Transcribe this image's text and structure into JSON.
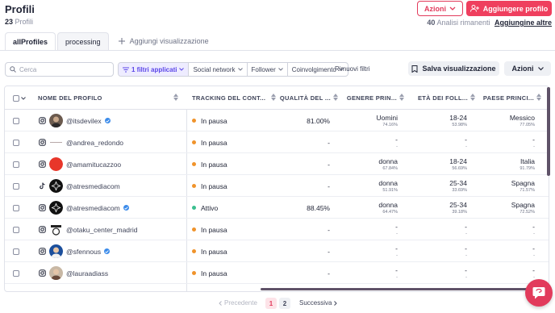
{
  "header": {
    "title": "Profili",
    "count": "23",
    "count_label": "Profili"
  },
  "top_actions": {
    "azioni_label": "Azioni",
    "add_label": "Aggiungere profilo",
    "remaining_count": "40",
    "remaining_label": "Analisi rimanenti",
    "add_more_label": "Aggiungine altre"
  },
  "tabs": [
    {
      "label": "allProfiles",
      "active": true
    },
    {
      "label": "processing",
      "active": false
    }
  ],
  "add_view_label": "Aggiungi visualizzazione",
  "toolbar": {
    "search_placeholder": "Cerca",
    "filters_applied": "1 filtri applicati",
    "filter_social": "Social network",
    "filter_follower": "Follower",
    "filter_engagement": "Coinvolgimento",
    "clear_filters": "Rimuovi filtri",
    "save_view": "Salva visualizzazione",
    "azioni": "Azioni"
  },
  "table": {
    "columns": [
      "NOME DEL PROFILO",
      "TRACKING DEL CONT...",
      "QUALITÀ DEL ...",
      "GENERE PRIN...",
      "ETÀ DEI FOLL...",
      "PAESE PRINCI..."
    ],
    "rows": [
      {
        "platform": "instagram",
        "handle": "@itsdevilex",
        "verified": true,
        "avatar": "photo-dark",
        "status": "In pausa",
        "status_color": "#f0932b",
        "quality": "81.00%",
        "gender": "Uomini",
        "gender_pct": "74.16%",
        "age": "18-24",
        "age_pct": "53.98%",
        "country": "Messico",
        "country_pct": "77.05%"
      },
      {
        "platform": "instagram",
        "handle": "@andrea_redondo",
        "verified": false,
        "avatar": "logo-text",
        "status": "In pausa",
        "status_color": "#f0932b",
        "quality": "-",
        "gender": "-",
        "gender_pct": "-",
        "age": "-",
        "age_pct": "-",
        "country": "-",
        "country_pct": "-"
      },
      {
        "platform": "instagram",
        "handle": "@amamitucazzoo",
        "verified": false,
        "avatar": "red-circle",
        "status": "In pausa",
        "status_color": "#f0932b",
        "quality": "-",
        "gender": "donna",
        "gender_pct": "67.84%",
        "age": "18-24",
        "age_pct": "56.69%",
        "country": "Italia",
        "country_pct": "91.79%"
      },
      {
        "platform": "tiktok",
        "handle": "@atresmediacom",
        "verified": false,
        "avatar": "black-logo",
        "status": "In pausa",
        "status_color": "#f0932b",
        "quality": "-",
        "gender": "donna",
        "gender_pct": "51.91%",
        "age": "25-34",
        "age_pct": "33.69%",
        "country": "Spagna",
        "country_pct": "71.57%"
      },
      {
        "platform": "instagram",
        "handle": "@atresmediacom",
        "verified": true,
        "avatar": "black-logo",
        "status": "Attivo",
        "status_color": "#3bbf8f",
        "quality": "88.45%",
        "gender": "donna",
        "gender_pct": "64.47%",
        "age": "25-34",
        "age_pct": "39.18%",
        "country": "Spagna",
        "country_pct": "72.52%"
      },
      {
        "platform": "instagram",
        "handle": "@otaku_center_madrid",
        "verified": false,
        "avatar": "otaku-logo",
        "status": "In pausa",
        "status_color": "#f0932b",
        "quality": "-",
        "gender": "-",
        "gender_pct": "-",
        "age": "-",
        "age_pct": "-",
        "country": "-",
        "country_pct": "-"
      },
      {
        "platform": "instagram",
        "handle": "@sfennous",
        "verified": true,
        "avatar": "photo-blue",
        "status": "In pausa",
        "status_color": "#f0932b",
        "quality": "-",
        "gender": "-",
        "gender_pct": "-",
        "age": "-",
        "age_pct": "-",
        "country": "-",
        "country_pct": "-"
      },
      {
        "platform": "instagram",
        "handle": "@lauraadiass",
        "verified": false,
        "avatar": "photo-light",
        "status": "In pausa",
        "status_color": "#f0932b",
        "quality": "-",
        "gender": "-",
        "gender_pct": "-",
        "age": "-",
        "age_pct": "-",
        "country": "-",
        "country_pct": "-"
      }
    ]
  },
  "pagination": {
    "prev": "Precedente",
    "pages": [
      "1",
      "2"
    ],
    "current": "1",
    "next": "Successiva"
  },
  "colors": {
    "brand": "#ef3f5e",
    "accent_purple": "#5b46e8",
    "paused": "#f0932b",
    "active": "#3bbf8f",
    "scrollbar": "#5f5268"
  }
}
